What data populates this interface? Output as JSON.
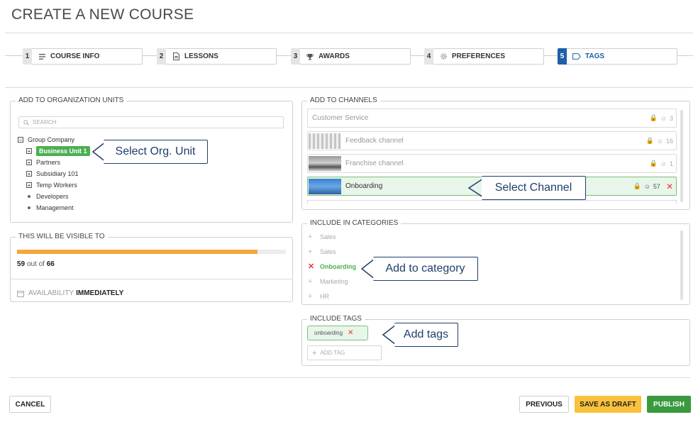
{
  "page": {
    "title": "CREATE A NEW COURSE"
  },
  "steps": [
    {
      "num": "1",
      "label": "COURSE INFO",
      "icon": "list-icon"
    },
    {
      "num": "2",
      "label": "LESSONS",
      "icon": "document-icon"
    },
    {
      "num": "3",
      "label": "AWARDS",
      "icon": "trophy-icon"
    },
    {
      "num": "4",
      "label": "PREFERENCES",
      "icon": "gear-icon"
    },
    {
      "num": "5",
      "label": "TAGS",
      "icon": "tag-icon",
      "active": true
    }
  ],
  "org": {
    "legend": "ADD TO ORGANIZATION UNITS",
    "search_placeholder": "SEARCH",
    "tree": [
      {
        "label": "Group Company",
        "toggle": "−"
      },
      {
        "label": "Business Unit 1",
        "toggle": "+",
        "selected": true
      },
      {
        "label": "Partners",
        "toggle": "+"
      },
      {
        "label": "Subsidiary 101",
        "toggle": "+"
      },
      {
        "label": "Temp Workers",
        "toggle": "+"
      },
      {
        "label": "Developers"
      },
      {
        "label": "Management"
      }
    ],
    "callout": "Select Org. Unit"
  },
  "visible": {
    "legend": "THIS WILL BE VISIBLE TO",
    "count": "59",
    "of_text": "out of",
    "total": "66",
    "progress": 0.894,
    "availability_label": "AVAILABILITY",
    "availability_value": "IMMEDIATELY"
  },
  "channels": {
    "legend": "ADD TO CHANNELS",
    "items": [
      {
        "name": "Customer Service",
        "count": "3"
      },
      {
        "name": "Feedback channel",
        "count": "16"
      },
      {
        "name": "Franchise channel",
        "count": "1"
      },
      {
        "name": "Onboarding",
        "count": "57",
        "selected": true
      }
    ],
    "callout": "Select Channel"
  },
  "categories": {
    "legend": "INCLUDE IN CATEGORIES",
    "items": [
      {
        "label": "Sales"
      },
      {
        "label": "Sales"
      },
      {
        "label": "Onboarding",
        "selected": true
      },
      {
        "label": "Marketing"
      },
      {
        "label": "HR"
      }
    ],
    "callout": "Add to category"
  },
  "tags": {
    "legend": "INCLUDE TAGS",
    "items": [
      {
        "label": "onboarding"
      }
    ],
    "add_label": "ADD TAG",
    "callout": "Add tags"
  },
  "buttons": {
    "cancel": "CANCEL",
    "previous": "PREVIOUS",
    "save_draft": "SAVE AS DRAFT",
    "publish": "PUBLISH"
  },
  "colors": {
    "accent_blue": "#1d5fa8",
    "green": "#4caf50",
    "progress": "#f4a63c",
    "callout": "#1e3e6b",
    "remove": "#e53935"
  }
}
